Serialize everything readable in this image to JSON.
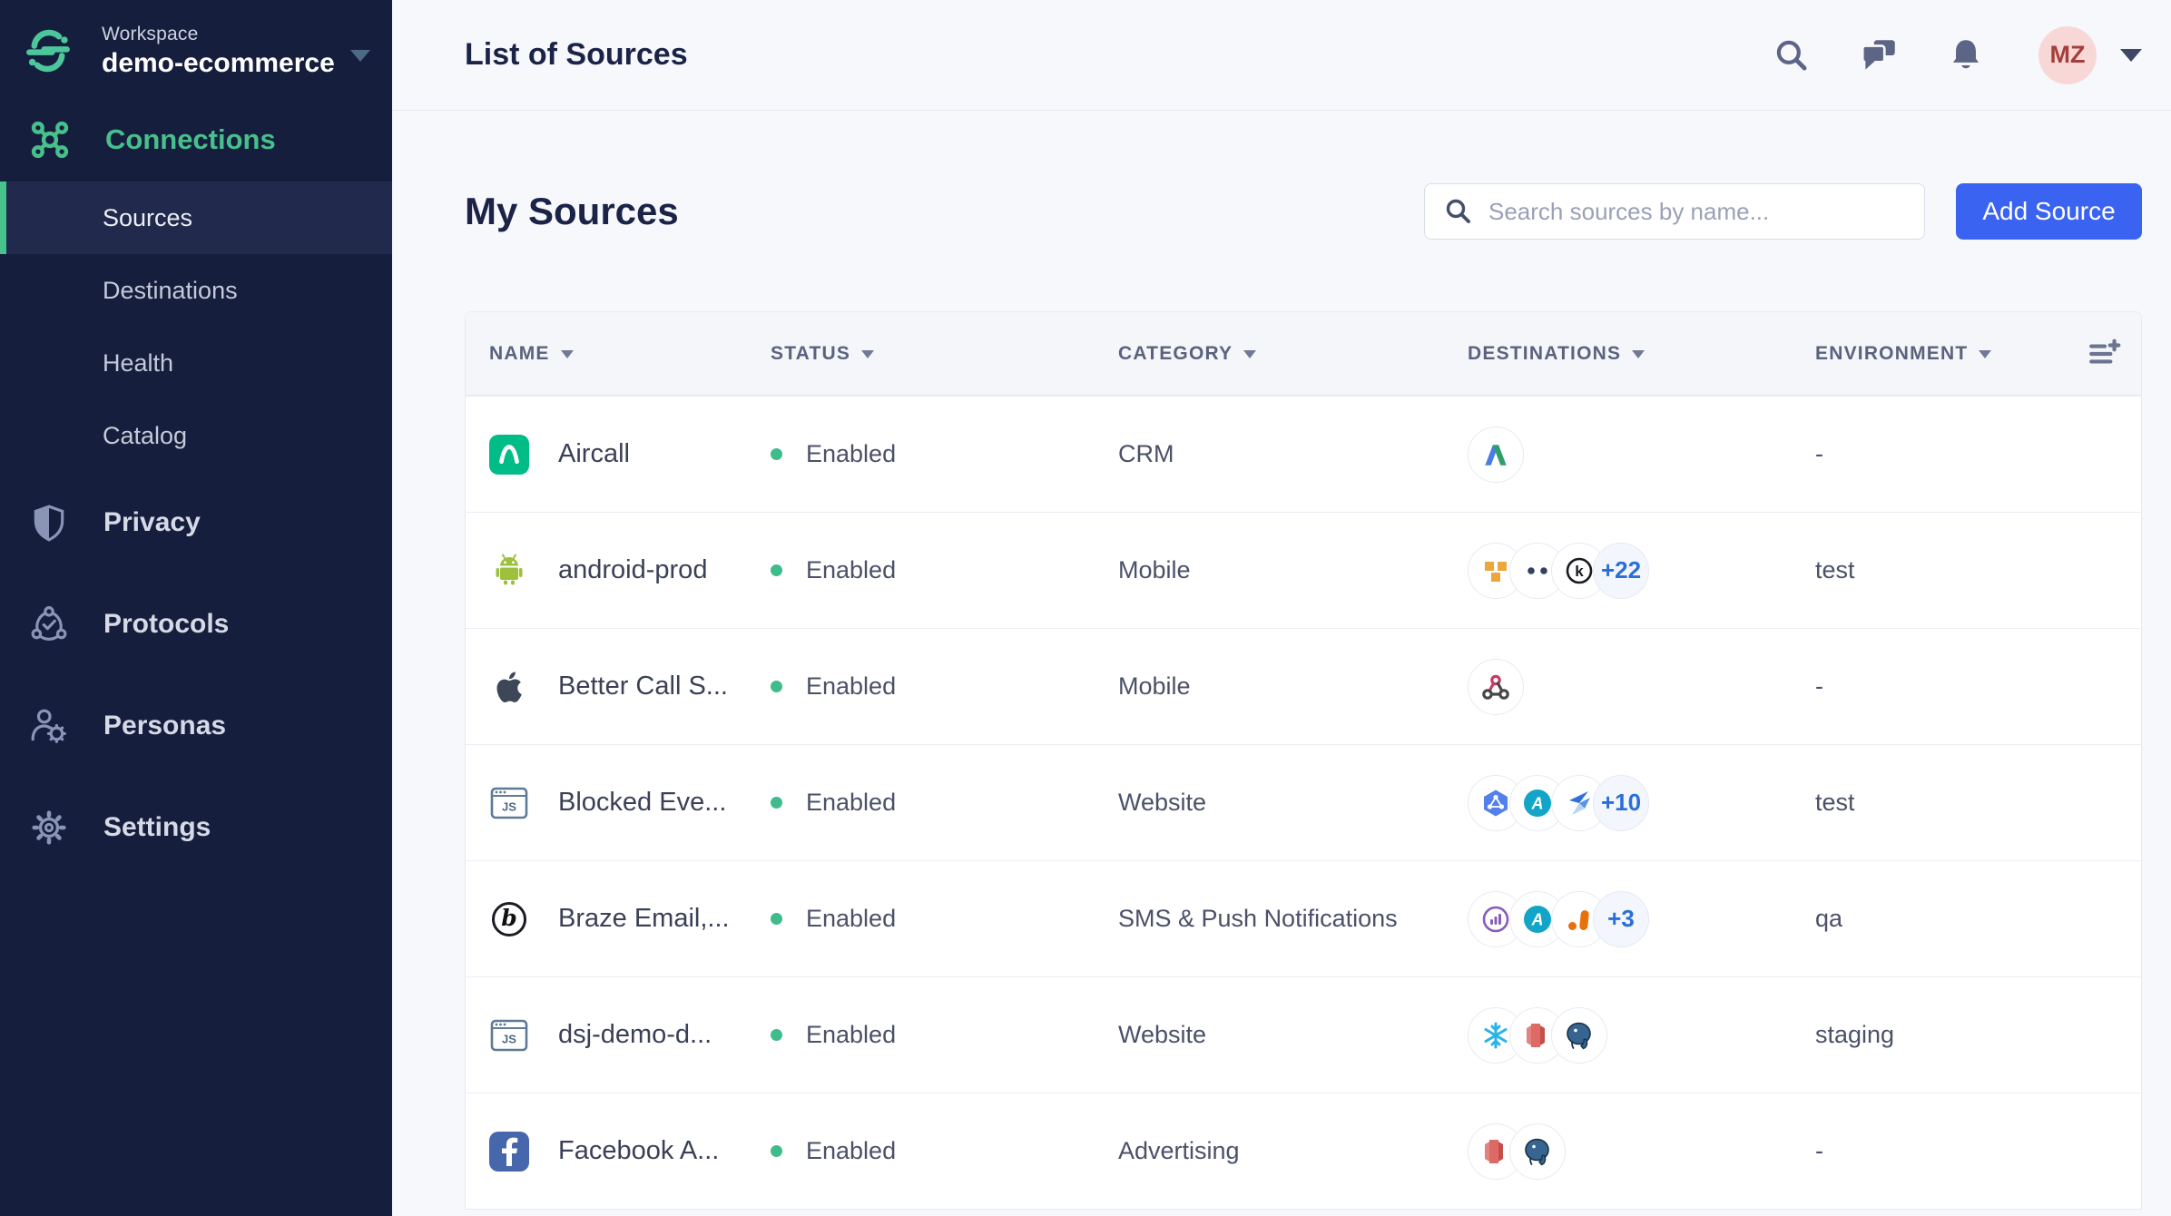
{
  "colors": {
    "sidebar_bg": "#161e3e",
    "accent_green": "#45c38b",
    "button_blue": "#3b63f1",
    "enabled_green": "#3fbc8c",
    "avatar_bg": "#f8d8d6",
    "avatar_text": "#a43f3b"
  },
  "sidebar": {
    "workspace_label": "Workspace",
    "workspace_name": "demo-ecommerce",
    "connections_label": "Connections",
    "sub_items": [
      {
        "label": "Sources",
        "active": true
      },
      {
        "label": "Destinations",
        "active": false
      },
      {
        "label": "Health",
        "active": false
      },
      {
        "label": "Catalog",
        "active": false
      }
    ],
    "section_items": [
      {
        "label": "Privacy",
        "icon": "shield-icon"
      },
      {
        "label": "Protocols",
        "icon": "protocols-icon"
      },
      {
        "label": "Personas",
        "icon": "personas-icon"
      },
      {
        "label": "Settings",
        "icon": "gear-icon"
      }
    ]
  },
  "topbar": {
    "title": "List of Sources",
    "icons": [
      "search-icon",
      "chat-icon",
      "bell-icon"
    ],
    "avatar_initials": "MZ"
  },
  "content": {
    "heading": "My Sources",
    "search_placeholder": "Search sources by name...",
    "add_button": "Add Source"
  },
  "table": {
    "columns": [
      "NAME",
      "STATUS",
      "CATEGORY",
      "DESTINATIONS",
      "ENVIRONMENT"
    ],
    "rows": [
      {
        "name": "Aircall",
        "status": "Enabled",
        "category": "CRM",
        "source_icon": "aircall",
        "destination_icons": [
          "google-ads"
        ],
        "extra": "",
        "environment": "-"
      },
      {
        "name": "android-prod",
        "status": "Enabled",
        "category": "Mobile",
        "source_icon": "android",
        "destination_icons": [
          "aws",
          "two-dots",
          "circled-k"
        ],
        "extra": "+22",
        "environment": "test"
      },
      {
        "name": "Better Call S...",
        "status": "Enabled",
        "category": "Mobile",
        "source_icon": "apple-ios",
        "destination_icons": [
          "webhooks"
        ],
        "extra": "",
        "environment": "-"
      },
      {
        "name": "Blocked Eve...",
        "status": "Enabled",
        "category": "Website",
        "source_icon": "javascript-website",
        "destination_icons": [
          "pubsub-hexagon",
          "amplitude",
          "blue-chevrons"
        ],
        "extra": "+10",
        "environment": "test"
      },
      {
        "name": "Braze Email,...",
        "status": "Enabled",
        "category": "SMS & Push Notifications",
        "source_icon": "braze",
        "destination_icons": [
          "purple-ring-bars",
          "amplitude",
          "google-analytics"
        ],
        "extra": "+3",
        "environment": "qa"
      },
      {
        "name": "dsj-demo-d...",
        "status": "Enabled",
        "category": "Website",
        "source_icon": "javascript-website",
        "destination_icons": [
          "snowflake",
          "redshift",
          "postgres"
        ],
        "extra": "",
        "environment": "staging"
      },
      {
        "name": "Facebook A...",
        "status": "Enabled",
        "category": "Advertising",
        "source_icon": "facebook",
        "destination_icons": [
          "redshift",
          "postgres"
        ],
        "extra": "",
        "environment": "-"
      }
    ]
  }
}
